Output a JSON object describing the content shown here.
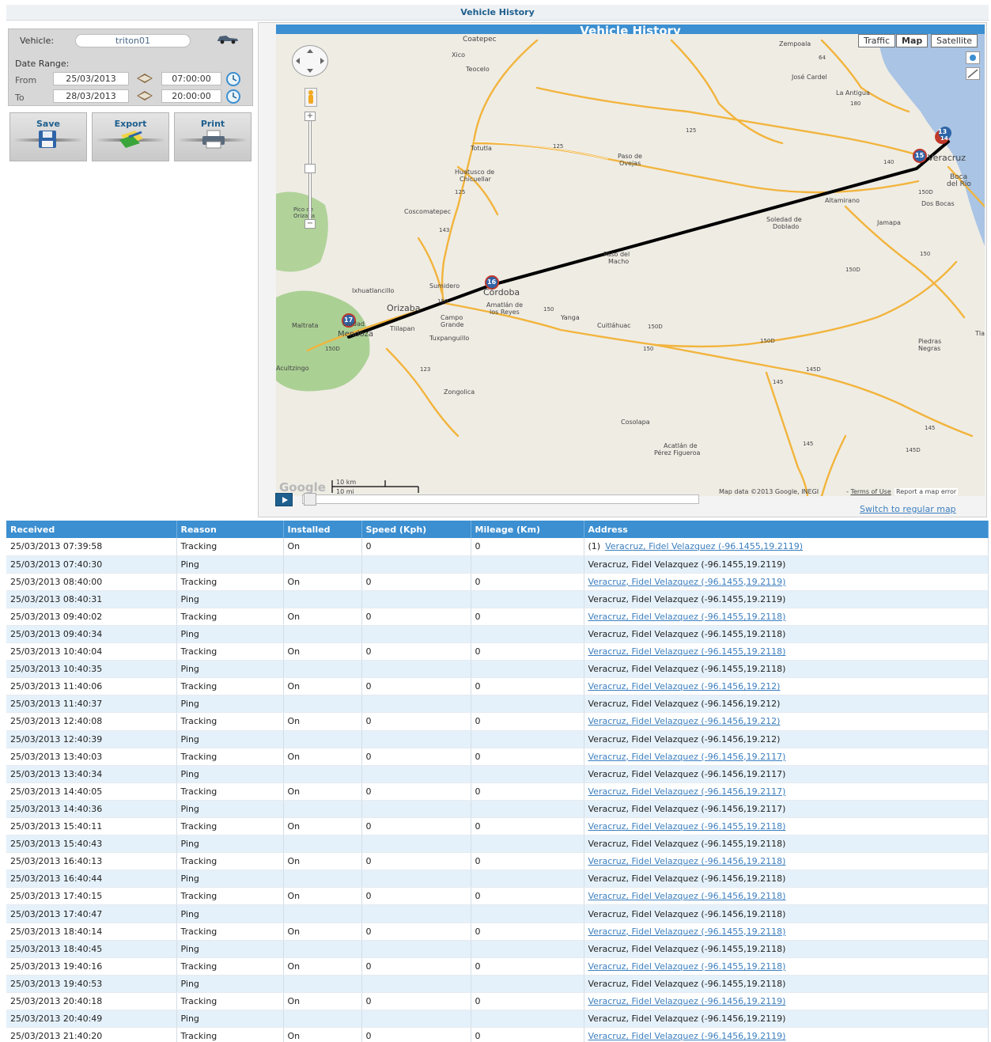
{
  "page": {
    "title": "Vehicle History"
  },
  "filter": {
    "vehicle_label": "Vehicle:",
    "vehicle_value": "triton01",
    "date_range_label": "Date Range:",
    "from_label": "From",
    "from_date": "25/03/2013",
    "from_time": "07:00:00",
    "to_label": "To",
    "to_date": "28/03/2013",
    "to_time": "20:00:00"
  },
  "actions": {
    "save": "Save",
    "export": "Export",
    "print": "Print"
  },
  "map": {
    "title": "Vehicle History",
    "types": [
      "Traffic",
      "Map",
      "Satellite"
    ],
    "selected_type": "Map",
    "places": [
      "Coatepec",
      "Xico",
      "Teocelo",
      "Zempoala",
      "José Cardel",
      "La Antigua",
      "Totutla",
      "Paso de",
      "Ovejas",
      "Huatusco de",
      "Chicuellar",
      "Veracruz",
      "Boca",
      "del Río",
      "Coscomatepec",
      "Altamirano",
      "Dos Bocas",
      "Soledad de",
      "Doblado",
      "Jamapa",
      "Paso del",
      "Macho",
      "Ixhuatlancillo",
      "Sumidero",
      "Córdoba",
      "Orizaba",
      "Amatlán de",
      "los Reyes",
      "Yanga",
      "Maltrata",
      "Ciudad",
      "Mendoza",
      "Tlilapan",
      "Campo",
      "Grande",
      "Cuitláhuac",
      "Tuxpanguillo",
      "Piedras",
      "Negras",
      "Acultzingo",
      "Zongolica",
      "Cosolapa",
      "Acatlán de",
      "Pérez Figueroa",
      "Pico de",
      "Orizaba",
      "Tla"
    ],
    "road_numbers": [
      "64",
      "180",
      "125",
      "125",
      "140",
      "125",
      "150D",
      "143",
      "150",
      "150",
      "150",
      "150D",
      "150D",
      "150D",
      "123",
      "145",
      "145",
      "145D",
      "145",
      "150D",
      "145D",
      "150"
    ],
    "markers": [
      "13",
      "14",
      "15",
      "16",
      "17"
    ],
    "scale": {
      "km": "10 km",
      "mi": "10 mi"
    },
    "attribution": "Map data ©2013 Google, INEGI",
    "terms_link": "Terms of Use",
    "report_link": "Report a map error",
    "logo": "Google",
    "zoom_in": "+",
    "zoom_out": "−"
  },
  "player": {
    "progress": 0
  },
  "switch_link": "Switch to regular map",
  "table": {
    "headers": [
      "Received",
      "Reason",
      "Installed",
      "Speed (Kph)",
      "Mileage (Km)",
      "Address"
    ],
    "rows": [
      [
        "25/03/2013 07:39:58",
        "Tracking",
        "On",
        "0",
        "0",
        "Veracruz, Fidel Velazquez (-96.1455,19.2119)",
        "(1)"
      ],
      [
        "25/03/2013 07:40:30",
        "Ping",
        "",
        "",
        "",
        "Veracruz, Fidel Velazquez (-96.1455,19.2119)",
        ""
      ],
      [
        "25/03/2013 08:40:00",
        "Tracking",
        "On",
        "0",
        "0",
        "Veracruz, Fidel Velazquez (-96.1455,19.2119)",
        ""
      ],
      [
        "25/03/2013 08:40:31",
        "Ping",
        "",
        "",
        "",
        "Veracruz, Fidel Velazquez (-96.1455,19.2119)",
        ""
      ],
      [
        "25/03/2013 09:40:02",
        "Tracking",
        "On",
        "0",
        "0",
        "Veracruz, Fidel Velazquez (-96.1455,19.2118)",
        ""
      ],
      [
        "25/03/2013 09:40:34",
        "Ping",
        "",
        "",
        "",
        "Veracruz, Fidel Velazquez (-96.1455,19.2118)",
        ""
      ],
      [
        "25/03/2013 10:40:04",
        "Tracking",
        "On",
        "0",
        "0",
        "Veracruz, Fidel Velazquez (-96.1455,19.2118)",
        ""
      ],
      [
        "25/03/2013 10:40:35",
        "Ping",
        "",
        "",
        "",
        "Veracruz, Fidel Velazquez (-96.1455,19.2118)",
        ""
      ],
      [
        "25/03/2013 11:40:06",
        "Tracking",
        "On",
        "0",
        "0",
        "Veracruz, Fidel Velazquez (-96.1456,19.212)",
        ""
      ],
      [
        "25/03/2013 11:40:37",
        "Ping",
        "",
        "",
        "",
        "Veracruz, Fidel Velazquez (-96.1456,19.212)",
        ""
      ],
      [
        "25/03/2013 12:40:08",
        "Tracking",
        "On",
        "0",
        "0",
        "Veracruz, Fidel Velazquez (-96.1456,19.212)",
        ""
      ],
      [
        "25/03/2013 12:40:39",
        "Ping",
        "",
        "",
        "",
        "Veracruz, Fidel Velazquez (-96.1456,19.212)",
        ""
      ],
      [
        "25/03/2013 13:40:03",
        "Tracking",
        "On",
        "0",
        "0",
        "Veracruz, Fidel Velazquez (-96.1456,19.2117)",
        ""
      ],
      [
        "25/03/2013 13:40:34",
        "Ping",
        "",
        "",
        "",
        "Veracruz, Fidel Velazquez (-96.1456,19.2117)",
        ""
      ],
      [
        "25/03/2013 14:40:05",
        "Tracking",
        "On",
        "0",
        "0",
        "Veracruz, Fidel Velazquez (-96.1456,19.2117)",
        ""
      ],
      [
        "25/03/2013 14:40:36",
        "Ping",
        "",
        "",
        "",
        "Veracruz, Fidel Velazquez (-96.1456,19.2117)",
        ""
      ],
      [
        "25/03/2013 15:40:11",
        "Tracking",
        "On",
        "0",
        "0",
        "Veracruz, Fidel Velazquez (-96.1455,19.2118)",
        ""
      ],
      [
        "25/03/2013 15:40:43",
        "Ping",
        "",
        "",
        "",
        "Veracruz, Fidel Velazquez (-96.1455,19.2118)",
        ""
      ],
      [
        "25/03/2013 16:40:13",
        "Tracking",
        "On",
        "0",
        "0",
        "Veracruz, Fidel Velazquez (-96.1456,19.2118)",
        ""
      ],
      [
        "25/03/2013 16:40:44",
        "Ping",
        "",
        "",
        "",
        "Veracruz, Fidel Velazquez (-96.1456,19.2118)",
        ""
      ],
      [
        "25/03/2013 17:40:15",
        "Tracking",
        "On",
        "0",
        "0",
        "Veracruz, Fidel Velazquez (-96.1456,19.2118)",
        ""
      ],
      [
        "25/03/2013 17:40:47",
        "Ping",
        "",
        "",
        "",
        "Veracruz, Fidel Velazquez (-96.1456,19.2118)",
        ""
      ],
      [
        "25/03/2013 18:40:14",
        "Tracking",
        "On",
        "0",
        "0",
        "Veracruz, Fidel Velazquez (-96.1455,19.2118)",
        ""
      ],
      [
        "25/03/2013 18:40:45",
        "Ping",
        "",
        "",
        "",
        "Veracruz, Fidel Velazquez (-96.1455,19.2118)",
        ""
      ],
      [
        "25/03/2013 19:40:16",
        "Tracking",
        "On",
        "0",
        "0",
        "Veracruz, Fidel Velazquez (-96.1455,19.2118)",
        ""
      ],
      [
        "25/03/2013 19:40:53",
        "Ping",
        "",
        "",
        "",
        "Veracruz, Fidel Velazquez (-96.1455,19.2118)",
        ""
      ],
      [
        "25/03/2013 20:40:18",
        "Tracking",
        "On",
        "0",
        "0",
        "Veracruz, Fidel Velazquez (-96.1456,19.2119)",
        ""
      ],
      [
        "25/03/2013 20:40:49",
        "Ping",
        "",
        "",
        "",
        "Veracruz, Fidel Velazquez (-96.1456,19.2119)",
        ""
      ],
      [
        "25/03/2013 21:40:20",
        "Tracking",
        "On",
        "0",
        "0",
        "Veracruz, Fidel Velazquez (-96.1456,19.2119)",
        ""
      ]
    ]
  },
  "colors": {
    "accent": "#3c8fd0",
    "header_text": "#1e5f8e",
    "row_alt": "#e5f1fa",
    "link": "#3c7fbf",
    "route": "#000000",
    "road": "#f2b43c"
  },
  "icons": {
    "vehicle": "vehicle-icon",
    "calendar": "calendar-icon",
    "clock": "clock-icon",
    "save": "floppy-icon",
    "export": "export-icon",
    "print": "printer-icon",
    "pan": "pan-control-icon",
    "pegman": "pegman-icon",
    "layers": "layers-icon",
    "play": "play-icon"
  }
}
